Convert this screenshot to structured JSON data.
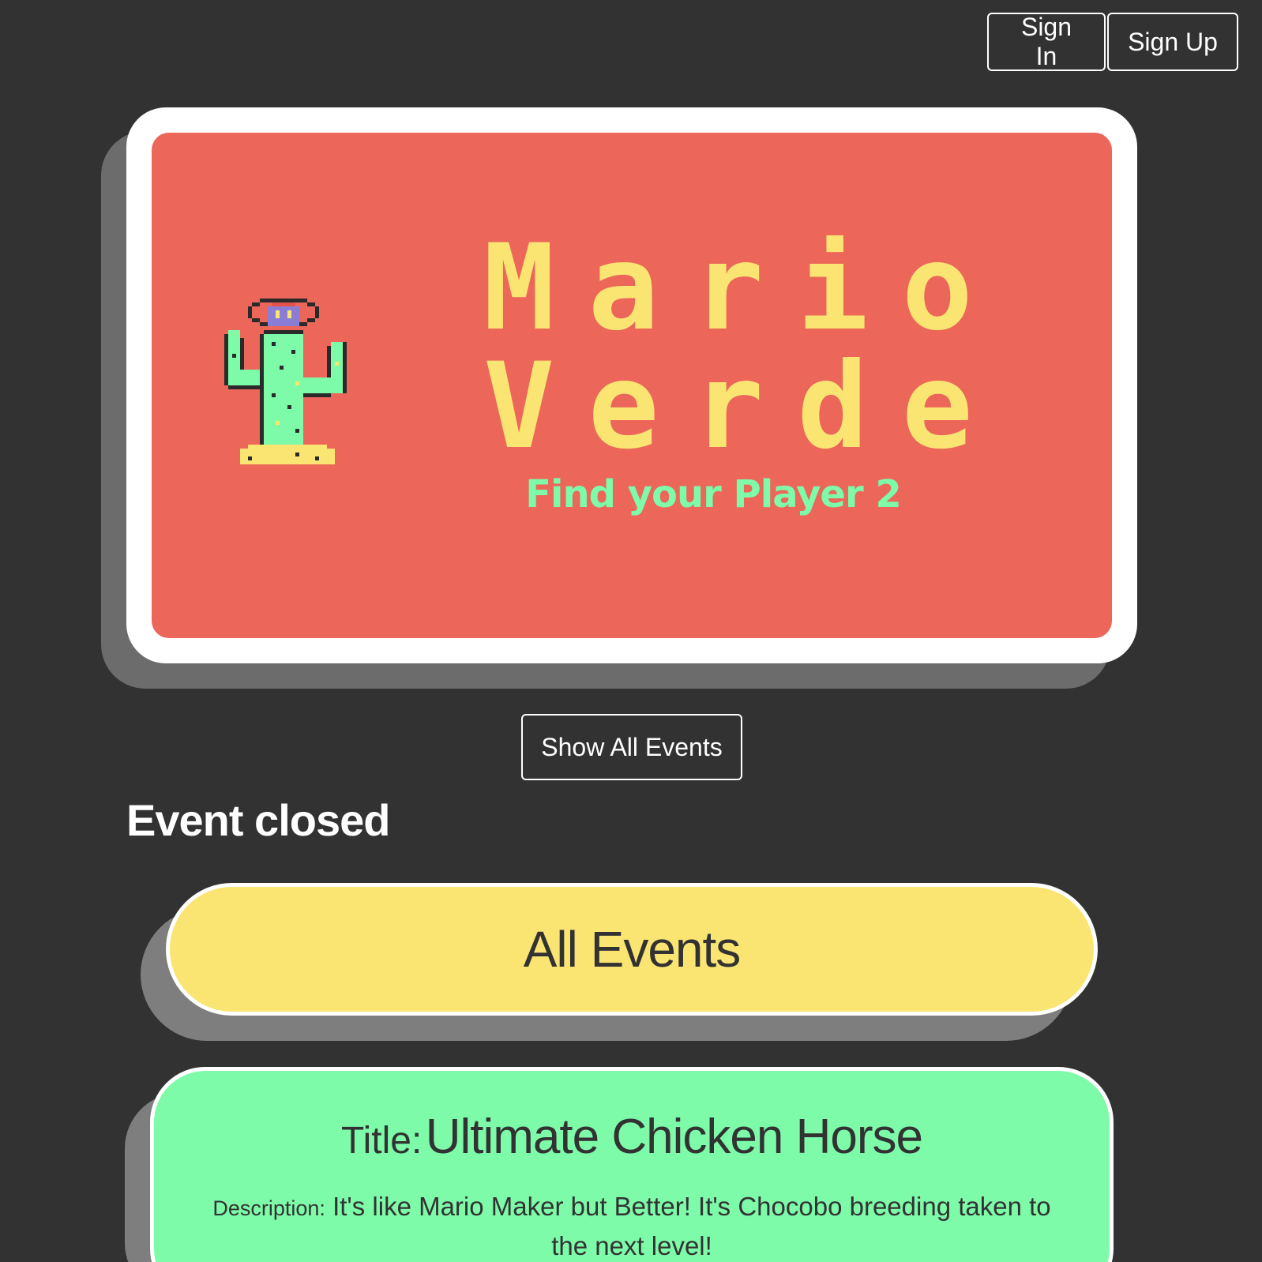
{
  "nav": {
    "sign_in": "Sign In",
    "sign_up": "Sign Up"
  },
  "hero": {
    "title_line1": "Mario",
    "title_line2": "Verde",
    "tagline": "Find your Player 2",
    "mascot_icon": "cactus-icon",
    "colors": {
      "background": "#ec665a",
      "title": "#fae573",
      "tagline": "#7dfba8"
    }
  },
  "show_all_button": "Show All Events",
  "event_status": "Event closed",
  "events_banner": "All Events",
  "event_card": {
    "title_label": "Title:",
    "title": "Ultimate Chicken Horse",
    "description_label": "Description:",
    "description": "It's like Mario Maker but Better! It's Chocobo breeding taken to the next level!"
  },
  "theme": {
    "page_background": "#323232",
    "banner": "#fae573",
    "card": "#7dfba8"
  }
}
